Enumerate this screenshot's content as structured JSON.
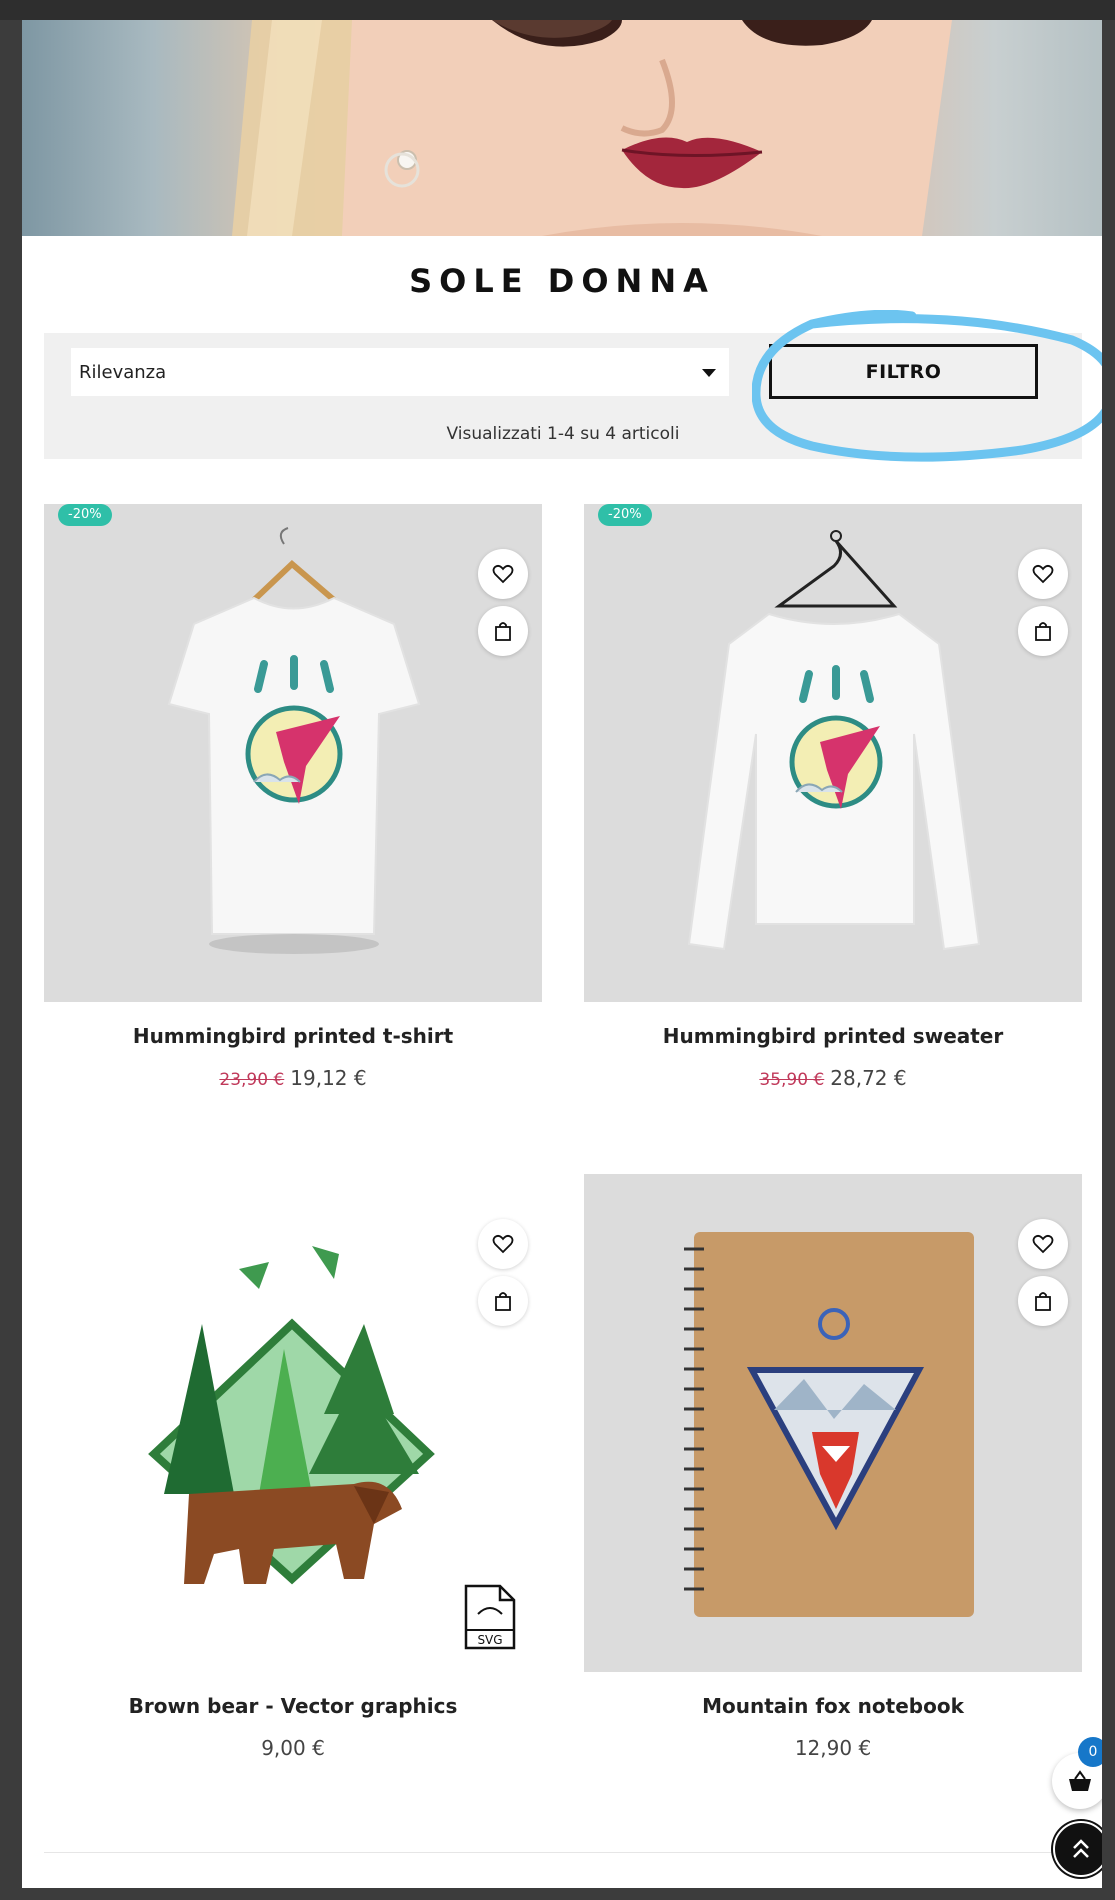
{
  "category": {
    "title": "SOLE DONNA"
  },
  "toolbar": {
    "sort_value": "Rilevanza",
    "filter_label": "FILTRO",
    "results_text": "Visualizzati 1-4 su 4 articoli"
  },
  "products": [
    {
      "name": "Hummingbird printed t-shirt",
      "old_price": "23,90 €",
      "price": "19,12 €",
      "badge": "-20%"
    },
    {
      "name": "Hummingbird printed sweater",
      "old_price": "35,90 €",
      "price": "28,72 €",
      "badge": "-20%"
    },
    {
      "name": "Brown bear - Vector graphics",
      "price": "9,00 €",
      "svg_label": "SVG"
    },
    {
      "name": "Mountain fox notebook",
      "price": "12,90 €"
    }
  ],
  "cart": {
    "count": "0"
  },
  "colors": {
    "badge": "#2fbfa8",
    "old_price": "#c0395a",
    "cart_badge": "#1677c9",
    "highlight": "#6cc4f0"
  },
  "icons": [
    "heart-icon",
    "shopping-bag-icon",
    "chevron-down-icon",
    "svg-file-icon",
    "basket-icon",
    "double-chevron-up-icon"
  ]
}
